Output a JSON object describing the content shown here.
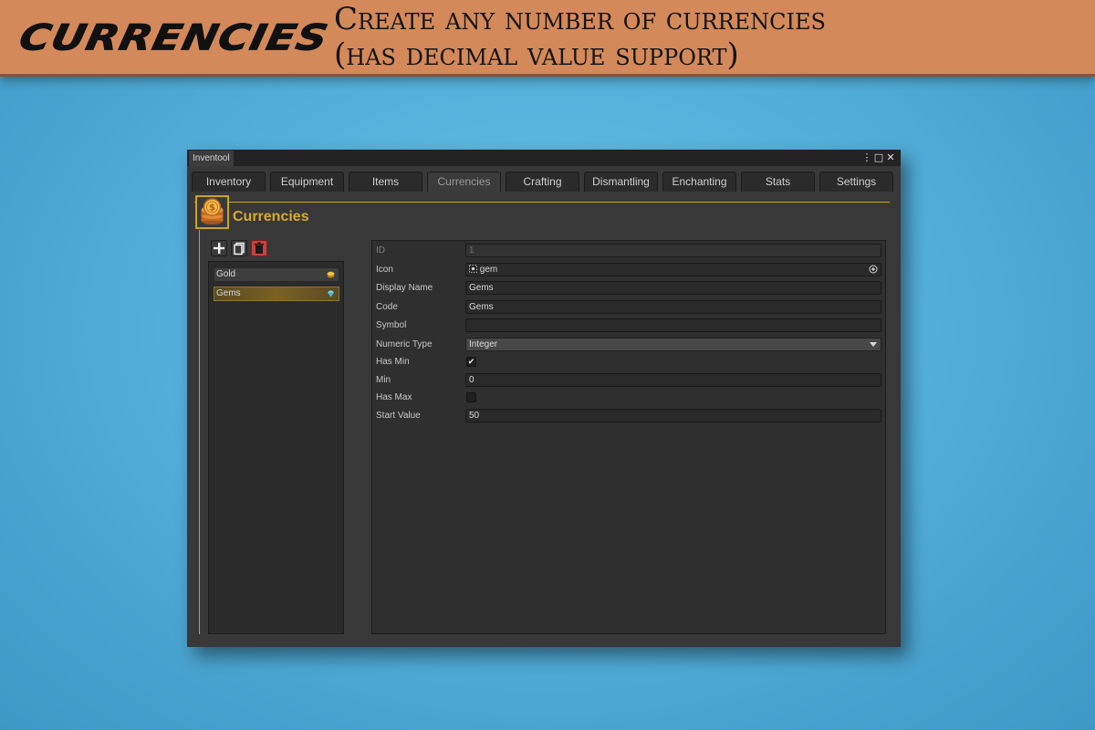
{
  "banner": {
    "logo_text": "CURRENCIES",
    "tagline_line1": "Create any number of currencies",
    "tagline_line2": "(has decimal value support)"
  },
  "window": {
    "title": "Inventool",
    "controls": {
      "menu": "⋮",
      "maximize": "□",
      "close": "✕"
    }
  },
  "tabs": [
    {
      "label": "Inventory",
      "active": false
    },
    {
      "label": "Equipment",
      "active": false
    },
    {
      "label": "Items",
      "active": false
    },
    {
      "label": "Currencies",
      "active": true
    },
    {
      "label": "Crafting",
      "active": false
    },
    {
      "label": "Dismantling",
      "active": false
    },
    {
      "label": "Enchanting",
      "active": false
    },
    {
      "label": "Stats",
      "active": false
    },
    {
      "label": "Settings",
      "active": false
    }
  ],
  "section": {
    "title": "Currencies",
    "icon": "coin-stack-icon"
  },
  "toolbar": {
    "add": {
      "icon": "plus-icon",
      "glyph": "+"
    },
    "duplicate": {
      "icon": "duplicate-icon",
      "glyph": "⧉"
    },
    "delete": {
      "icon": "trash-icon",
      "glyph": "🗑"
    }
  },
  "currencies": [
    {
      "name": "Gold",
      "icon": "gold-coin-icon",
      "selected": false
    },
    {
      "name": "Gems",
      "icon": "gem-icon",
      "selected": true
    }
  ],
  "details": {
    "id": {
      "label": "ID",
      "value": "1"
    },
    "icon": {
      "label": "Icon",
      "value": "gem"
    },
    "display_name": {
      "label": "Display Name",
      "value": "Gems"
    },
    "code": {
      "label": "Code",
      "value": "Gems"
    },
    "symbol": {
      "label": "Symbol",
      "value": ""
    },
    "numeric_type": {
      "label": "Numeric Type",
      "value": "Integer"
    },
    "has_min": {
      "label": "Has Min",
      "checked": true,
      "check_glyph": "✔"
    },
    "min": {
      "label": "Min",
      "value": "0"
    },
    "has_max": {
      "label": "Has Max",
      "checked": false
    },
    "start_value": {
      "label": "Start Value",
      "value": "50"
    }
  },
  "colors": {
    "accent_gold": "#c9a227",
    "banner_orange": "#d4895a",
    "window_bg": "#383838",
    "delete_red": "#c94040"
  }
}
